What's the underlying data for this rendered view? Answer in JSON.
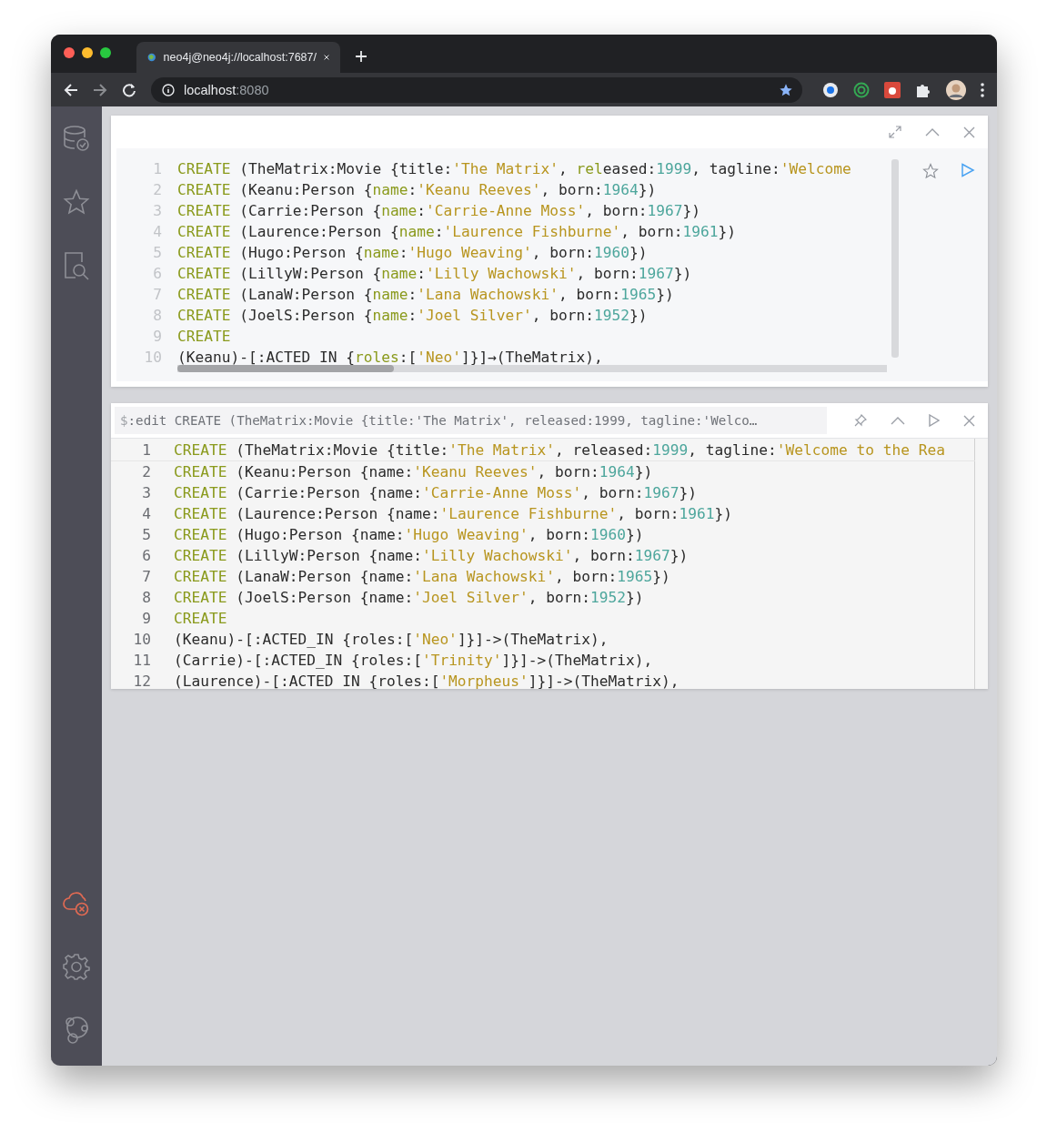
{
  "browser": {
    "tab_title": "neo4j@neo4j://localhost:7687/",
    "address": {
      "host": "localhost",
      "port": ":8080"
    }
  },
  "sidebar": {
    "items": [
      {
        "kind": "database",
        "selected": false
      },
      {
        "kind": "favorites",
        "selected": false
      },
      {
        "kind": "guides",
        "selected": false
      }
    ],
    "bottom_items": [
      {
        "kind": "connection-error",
        "error": true
      },
      {
        "kind": "settings",
        "error": false
      },
      {
        "kind": "about",
        "error": false
      }
    ]
  },
  "frames": [
    {
      "kind": "editor",
      "lines": [
        {
          "number": "1",
          "tokens": [
            {
              "kind": "keyword",
              "text": "CREATE"
            },
            {
              "kind": "plain",
              "text": " (TheMatrix:Movie {title:"
            },
            {
              "kind": "string",
              "text": "'The Matrix'"
            },
            {
              "kind": "plain",
              "text": ", "
            },
            {
              "kind": "keyword",
              "text": "rel"
            },
            {
              "kind": "plain",
              "text": "eased:"
            },
            {
              "kind": "number",
              "text": "1999"
            },
            {
              "kind": "plain",
              "text": ", tagline:"
            },
            {
              "kind": "string",
              "text": "'Welcome"
            }
          ]
        },
        {
          "number": "2",
          "tokens": [
            {
              "kind": "keyword",
              "text": "CREATE"
            },
            {
              "kind": "plain",
              "text": " (Keanu:Person {"
            },
            {
              "kind": "keyword",
              "text": "name"
            },
            {
              "kind": "plain",
              "text": ":"
            },
            {
              "kind": "string",
              "text": "'Keanu Reeves'"
            },
            {
              "kind": "plain",
              "text": ", born:"
            },
            {
              "kind": "number",
              "text": "1964"
            },
            {
              "kind": "plain",
              "text": "})"
            }
          ]
        },
        {
          "number": "3",
          "tokens": [
            {
              "kind": "keyword",
              "text": "CREATE"
            },
            {
              "kind": "plain",
              "text": " (Carrie:Person {"
            },
            {
              "kind": "keyword",
              "text": "name"
            },
            {
              "kind": "plain",
              "text": ":"
            },
            {
              "kind": "string",
              "text": "'Carrie-Anne Moss'"
            },
            {
              "kind": "plain",
              "text": ", born:"
            },
            {
              "kind": "number",
              "text": "1967"
            },
            {
              "kind": "plain",
              "text": "})"
            }
          ]
        },
        {
          "number": "4",
          "tokens": [
            {
              "kind": "keyword",
              "text": "CREATE"
            },
            {
              "kind": "plain",
              "text": " (Laurence:Person {"
            },
            {
              "kind": "keyword",
              "text": "name"
            },
            {
              "kind": "plain",
              "text": ":"
            },
            {
              "kind": "string",
              "text": "'Laurence Fishburne'"
            },
            {
              "kind": "plain",
              "text": ", born:"
            },
            {
              "kind": "number",
              "text": "1961"
            },
            {
              "kind": "plain",
              "text": "})"
            }
          ]
        },
        {
          "number": "5",
          "tokens": [
            {
              "kind": "keyword",
              "text": "CREATE"
            },
            {
              "kind": "plain",
              "text": " (Hugo:Person {"
            },
            {
              "kind": "keyword",
              "text": "name"
            },
            {
              "kind": "plain",
              "text": ":"
            },
            {
              "kind": "string",
              "text": "'Hugo Weaving'"
            },
            {
              "kind": "plain",
              "text": ", born:"
            },
            {
              "kind": "number",
              "text": "1960"
            },
            {
              "kind": "plain",
              "text": "})"
            }
          ]
        },
        {
          "number": "6",
          "tokens": [
            {
              "kind": "keyword",
              "text": "CREATE"
            },
            {
              "kind": "plain",
              "text": " (LillyW:Person {"
            },
            {
              "kind": "keyword",
              "text": "name"
            },
            {
              "kind": "plain",
              "text": ":"
            },
            {
              "kind": "string",
              "text": "'Lilly Wachowski'"
            },
            {
              "kind": "plain",
              "text": ", born:"
            },
            {
              "kind": "number",
              "text": "1967"
            },
            {
              "kind": "plain",
              "text": "})"
            }
          ]
        },
        {
          "number": "7",
          "tokens": [
            {
              "kind": "keyword",
              "text": "CREATE"
            },
            {
              "kind": "plain",
              "text": " (LanaW:Person {"
            },
            {
              "kind": "keyword",
              "text": "name"
            },
            {
              "kind": "plain",
              "text": ":"
            },
            {
              "kind": "string",
              "text": "'Lana Wachowski'"
            },
            {
              "kind": "plain",
              "text": ", born:"
            },
            {
              "kind": "number",
              "text": "1965"
            },
            {
              "kind": "plain",
              "text": "})"
            }
          ]
        },
        {
          "number": "8",
          "tokens": [
            {
              "kind": "keyword",
              "text": "CREATE"
            },
            {
              "kind": "plain",
              "text": " (JoelS:Person {"
            },
            {
              "kind": "keyword",
              "text": "name"
            },
            {
              "kind": "plain",
              "text": ":"
            },
            {
              "kind": "string",
              "text": "'Joel Silver'"
            },
            {
              "kind": "plain",
              "text": ", born:"
            },
            {
              "kind": "number",
              "text": "1952"
            },
            {
              "kind": "plain",
              "text": "})"
            }
          ]
        },
        {
          "number": "9",
          "tokens": [
            {
              "kind": "keyword",
              "text": "CREATE"
            }
          ]
        },
        {
          "number": "10",
          "tokens": [
            {
              "kind": "plain",
              "text": "(Keanu)-[:ACTED_IN {"
            },
            {
              "kind": "keyword",
              "text": "roles"
            },
            {
              "kind": "plain",
              "text": ":["
            },
            {
              "kind": "string",
              "text": "'Neo'"
            },
            {
              "kind": "plain",
              "text": "]}]→(TheMatrix),"
            }
          ]
        }
      ]
    },
    {
      "kind": "result",
      "prompt": "$",
      "command": ":edit CREATE (TheMatrix:Movie {title:'The Matrix', released:1999, tagline:'Welco…",
      "lines": [
        {
          "number": "1",
          "tokens": [
            {
              "kind": "keyword",
              "text": "CREATE"
            },
            {
              "kind": "plain",
              "text": " (TheMatrix:Movie {title:"
            },
            {
              "kind": "string",
              "text": "'The Matrix'"
            },
            {
              "kind": "plain",
              "text": ", released:"
            },
            {
              "kind": "number",
              "text": "1999"
            },
            {
              "kind": "plain",
              "text": ", tagline:"
            },
            {
              "kind": "string",
              "text": "'Welcome to the Rea"
            }
          ]
        },
        {
          "number": "2",
          "tokens": [
            {
              "kind": "keyword",
              "text": "CREATE"
            },
            {
              "kind": "plain",
              "text": " (Keanu:Person {name:"
            },
            {
              "kind": "string",
              "text": "'Keanu Reeves'"
            },
            {
              "kind": "plain",
              "text": ", born:"
            },
            {
              "kind": "number",
              "text": "1964"
            },
            {
              "kind": "plain",
              "text": "})"
            }
          ]
        },
        {
          "number": "3",
          "tokens": [
            {
              "kind": "keyword",
              "text": "CREATE"
            },
            {
              "kind": "plain",
              "text": " (Carrie:Person {name:"
            },
            {
              "kind": "string",
              "text": "'Carrie-Anne Moss'"
            },
            {
              "kind": "plain",
              "text": ", born:"
            },
            {
              "kind": "number",
              "text": "1967"
            },
            {
              "kind": "plain",
              "text": "})"
            }
          ]
        },
        {
          "number": "4",
          "tokens": [
            {
              "kind": "keyword",
              "text": "CREATE"
            },
            {
              "kind": "plain",
              "text": " (Laurence:Person {name:"
            },
            {
              "kind": "string",
              "text": "'Laurence Fishburne'"
            },
            {
              "kind": "plain",
              "text": ", born:"
            },
            {
              "kind": "number",
              "text": "1961"
            },
            {
              "kind": "plain",
              "text": "})"
            }
          ]
        },
        {
          "number": "5",
          "tokens": [
            {
              "kind": "keyword",
              "text": "CREATE"
            },
            {
              "kind": "plain",
              "text": " (Hugo:Person {name:"
            },
            {
              "kind": "string",
              "text": "'Hugo Weaving'"
            },
            {
              "kind": "plain",
              "text": ", born:"
            },
            {
              "kind": "number",
              "text": "1960"
            },
            {
              "kind": "plain",
              "text": "})"
            }
          ]
        },
        {
          "number": "6",
          "tokens": [
            {
              "kind": "keyword",
              "text": "CREATE"
            },
            {
              "kind": "plain",
              "text": " (LillyW:Person {name:"
            },
            {
              "kind": "string",
              "text": "'Lilly Wachowski'"
            },
            {
              "kind": "plain",
              "text": ", born:"
            },
            {
              "kind": "number",
              "text": "1967"
            },
            {
              "kind": "plain",
              "text": "})"
            }
          ]
        },
        {
          "number": "7",
          "tokens": [
            {
              "kind": "keyword",
              "text": "CREATE"
            },
            {
              "kind": "plain",
              "text": " (LanaW:Person {name:"
            },
            {
              "kind": "string",
              "text": "'Lana Wachowski'"
            },
            {
              "kind": "plain",
              "text": ", born:"
            },
            {
              "kind": "number",
              "text": "1965"
            },
            {
              "kind": "plain",
              "text": "})"
            }
          ]
        },
        {
          "number": "8",
          "tokens": [
            {
              "kind": "keyword",
              "text": "CREATE"
            },
            {
              "kind": "plain",
              "text": " (JoelS:Person {name:"
            },
            {
              "kind": "string",
              "text": "'Joel Silver'"
            },
            {
              "kind": "plain",
              "text": ", born:"
            },
            {
              "kind": "number",
              "text": "1952"
            },
            {
              "kind": "plain",
              "text": "})"
            }
          ]
        },
        {
          "number": "9",
          "tokens": [
            {
              "kind": "keyword",
              "text": "CREATE"
            }
          ]
        },
        {
          "number": "10",
          "tokens": [
            {
              "kind": "plain",
              "text": "(Keanu)-[:ACTED_IN {roles:["
            },
            {
              "kind": "string",
              "text": "'Neo'"
            },
            {
              "kind": "plain",
              "text": "]}]->(TheMatrix),"
            }
          ]
        },
        {
          "number": "11",
          "tokens": [
            {
              "kind": "plain",
              "text": "(Carrie)-[:ACTED_IN {roles:["
            },
            {
              "kind": "string",
              "text": "'Trinity'"
            },
            {
              "kind": "plain",
              "text": "]}]->(TheMatrix),"
            }
          ]
        },
        {
          "number": "12",
          "tokens": [
            {
              "kind": "plain",
              "text": "(Laurence)-[:ACTED_IN {roles:["
            },
            {
              "kind": "string",
              "text": "'Morpheus'"
            },
            {
              "kind": "plain",
              "text": "]}]->(TheMatrix),"
            }
          ]
        }
      ]
    }
  ]
}
